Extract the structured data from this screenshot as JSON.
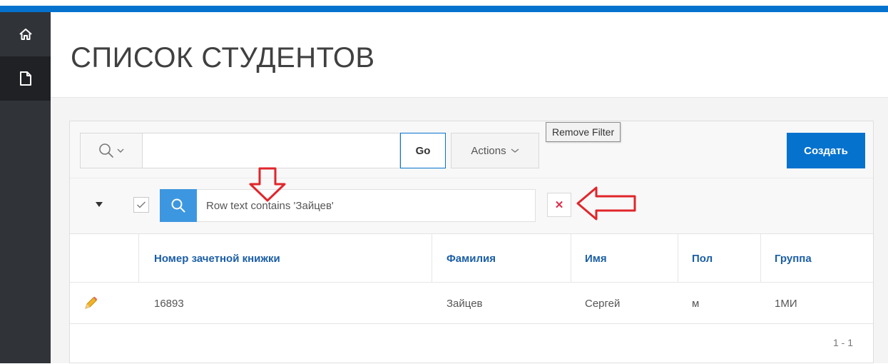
{
  "app": {
    "accent_color": "#0572ce",
    "sidebar": {
      "items": [
        {
          "icon": "home-icon"
        },
        {
          "icon": "page-icon",
          "active": true
        }
      ]
    }
  },
  "page": {
    "title": "СПИСОК СТУДЕНТОВ"
  },
  "toolbar": {
    "search_value": "",
    "search_placeholder": "",
    "go_label": "Go",
    "actions_label": "Actions",
    "create_label": "Создать"
  },
  "filter": {
    "checked": true,
    "text": "Row text contains 'Зайцев'",
    "remove_symbol": "✕",
    "tooltip": "Remove Filter"
  },
  "table": {
    "columns": [
      "Номер зачетной книжки",
      "Фамилия",
      "Имя",
      "Пол",
      "Группа"
    ],
    "rows": [
      [
        "16893",
        "Зайцев",
        "Сергей",
        "м",
        "1МИ"
      ]
    ]
  },
  "pagination": {
    "range": "1 - 1"
  }
}
